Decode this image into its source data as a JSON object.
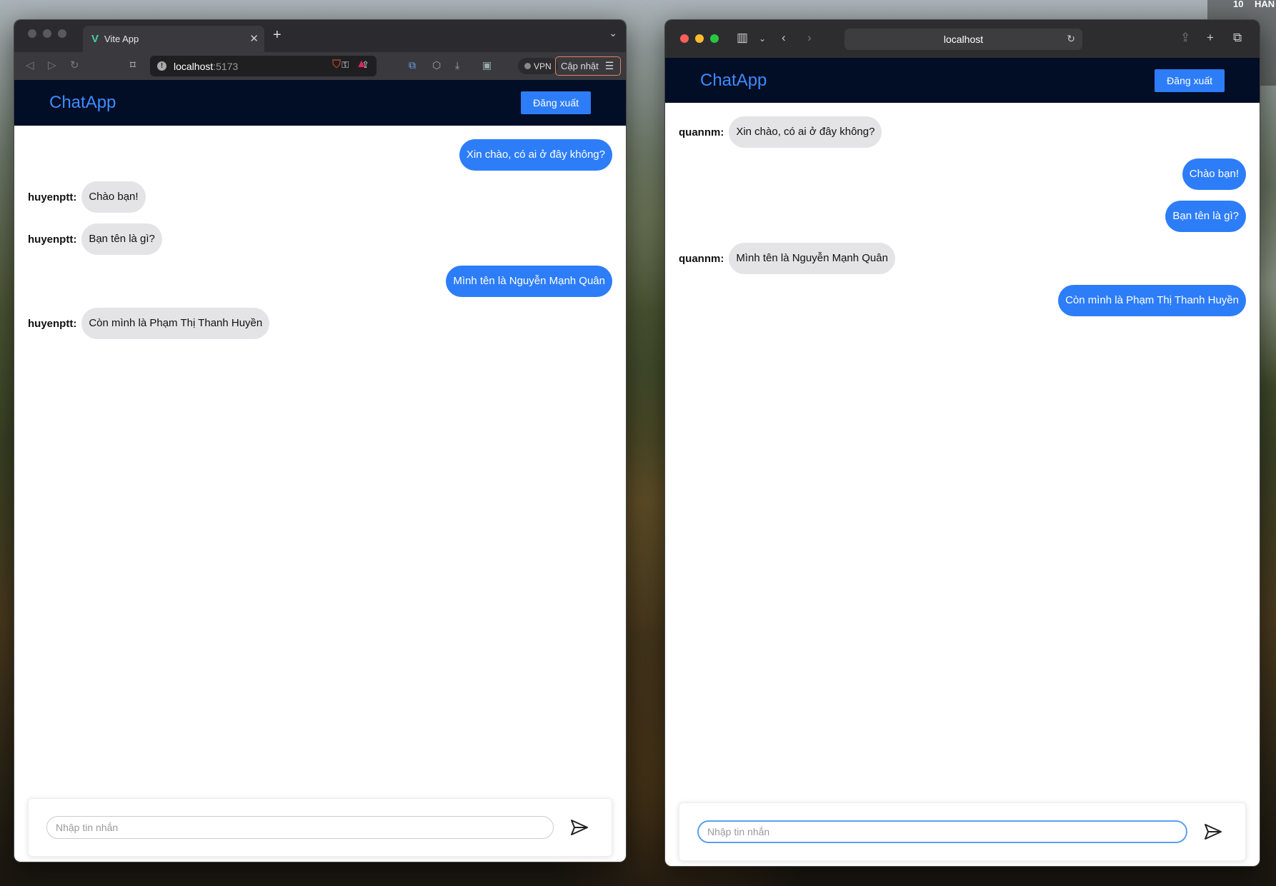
{
  "desktop": {
    "widget_num": "10",
    "widget_text": "HAN"
  },
  "window1": {
    "tab_title": "Vite App",
    "url_host": "localhost",
    "url_port": ":5173",
    "vpn_label": "VPN",
    "update_label": "Cập nhật",
    "app": {
      "brand": "ChatApp",
      "logout_label": "Đăng xuất",
      "messages": [
        {
          "mine": true,
          "sender": "",
          "text": "Xin chào, có ai ở đây không?"
        },
        {
          "mine": false,
          "sender": "huyenptt:",
          "text": "Chào bạn!"
        },
        {
          "mine": false,
          "sender": "huyenptt:",
          "text": "Bạn tên là gì?"
        },
        {
          "mine": true,
          "sender": "",
          "text": "Mình tên là Nguyễn Mạnh Quân"
        },
        {
          "mine": false,
          "sender": "huyenptt:",
          "text": "Còn mình là Phạm Thị Thanh Huyền"
        }
      ],
      "input_placeholder": "Nhập tin nhắn",
      "input_value": ""
    }
  },
  "window2": {
    "url": "localhost",
    "app": {
      "brand": "ChatApp",
      "logout_label": "Đăng xuất",
      "messages": [
        {
          "mine": false,
          "sender": "quannm:",
          "text": "Xin chào, có ai ở đây không?"
        },
        {
          "mine": true,
          "sender": "",
          "text": "Chào bạn!"
        },
        {
          "mine": true,
          "sender": "",
          "text": "Bạn tên là gì?"
        },
        {
          "mine": false,
          "sender": "quannm:",
          "text": "Mình tên là Nguyễn Mạnh Quân"
        },
        {
          "mine": true,
          "sender": "",
          "text": "Còn mình là Phạm Thị Thanh Huyền"
        }
      ],
      "input_placeholder": "Nhập tin nhắn",
      "input_value": ""
    }
  },
  "colors": {
    "header_bg": "#020d26",
    "brand": "#3d8bfd",
    "primary": "#2d7df8",
    "bubble_other": "#e4e4e6"
  }
}
